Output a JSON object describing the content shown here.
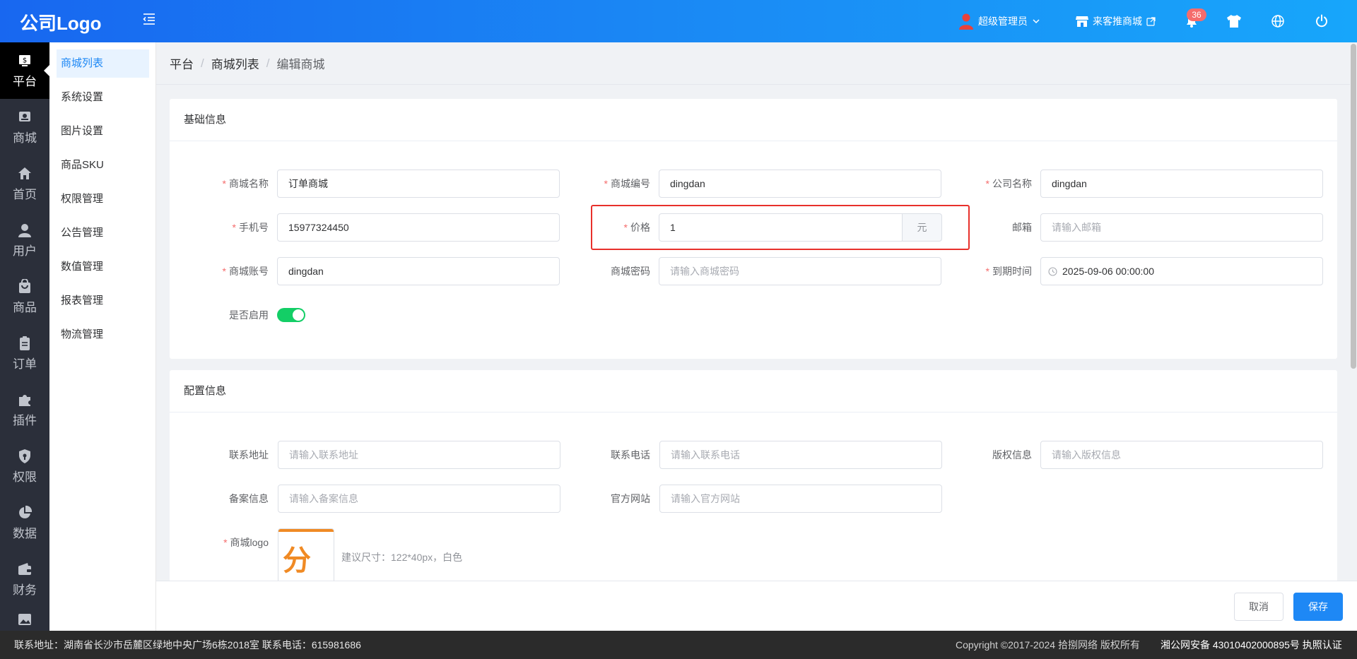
{
  "header": {
    "logo_text": "公司Logo",
    "user_label": "超级管理员",
    "store_link_label": "来客推商城",
    "notification_count": "36",
    "icons": [
      "menu-fold-icon",
      "user-avatar-icon",
      "chevron-down-icon",
      "store-icon",
      "external-link-icon",
      "bell-icon",
      "shirt-icon",
      "globe-icon",
      "power-icon"
    ],
    "colors": {
      "gradient_start": "#1867f0",
      "gradient_end": "#17a6fb",
      "badge": "#f56c6c"
    }
  },
  "rail": {
    "items": [
      {
        "label": "平台",
        "icon": "platform-icon",
        "active": true
      },
      {
        "label": "商城",
        "icon": "shop-icon"
      },
      {
        "label": "首页",
        "icon": "home-icon"
      },
      {
        "label": "用户",
        "icon": "user-icon"
      },
      {
        "label": "商品",
        "icon": "goods-icon"
      },
      {
        "label": "订单",
        "icon": "order-icon"
      },
      {
        "label": "插件",
        "icon": "plugin-icon"
      },
      {
        "label": "权限",
        "icon": "permission-icon"
      },
      {
        "label": "数据",
        "icon": "data-icon"
      },
      {
        "label": "财务",
        "icon": "finance-icon"
      }
    ]
  },
  "submenu": {
    "items": [
      {
        "label": "商城列表",
        "active": true
      },
      {
        "label": "系统设置"
      },
      {
        "label": "图片设置"
      },
      {
        "label": "商品SKU"
      },
      {
        "label": "权限管理"
      },
      {
        "label": "公告管理"
      },
      {
        "label": "数值管理"
      },
      {
        "label": "报表管理"
      },
      {
        "label": "物流管理"
      }
    ]
  },
  "breadcrumb": {
    "items": [
      "平台",
      "商城列表",
      "编辑商城"
    ],
    "separator": "/"
  },
  "basic": {
    "title": "基础信息",
    "shop_name": {
      "label": "商城名称",
      "value": "订单商城"
    },
    "shop_code": {
      "label": "商城编号",
      "value": "dingdan"
    },
    "company_name": {
      "label": "公司名称",
      "value": "dingdan"
    },
    "phone": {
      "label": "手机号",
      "value": "15977324450"
    },
    "price": {
      "label": "价格",
      "value": "1",
      "unit": "元"
    },
    "email": {
      "label": "邮箱",
      "placeholder": "请输入邮箱"
    },
    "account": {
      "label": "商城账号",
      "value": "dingdan"
    },
    "password": {
      "label": "商城密码",
      "placeholder": "请输入商城密码"
    },
    "expire": {
      "label": "到期时间",
      "value": "2025-09-06 00:00:00"
    },
    "enabled": {
      "label": "是否启用",
      "on": true
    }
  },
  "config": {
    "title": "配置信息",
    "address": {
      "label": "联系地址",
      "placeholder": "请输入联系地址"
    },
    "contact_phone": {
      "label": "联系电话",
      "placeholder": "请输入联系电话"
    },
    "copyright": {
      "label": "版权信息",
      "placeholder": "请输入版权信息"
    },
    "record": {
      "label": "备案信息",
      "placeholder": "请输入备案信息"
    },
    "website": {
      "label": "官方网站",
      "placeholder": "请输入官方网站"
    },
    "logo": {
      "label": "商城logo",
      "image_text": "分销",
      "hint": "建议尺寸：122*40px，白色"
    }
  },
  "actions": {
    "cancel": "取消",
    "save": "保存"
  },
  "footer": {
    "contact": "联系地址：湖南省长沙市岳麓区绿地中央广场6栋2018室 联系电话：615981686",
    "copyright": "Copyright ©2017-2024 拾捌网络 版权所有",
    "icp": "湘公网安备 43010402000895号 执照认证"
  }
}
